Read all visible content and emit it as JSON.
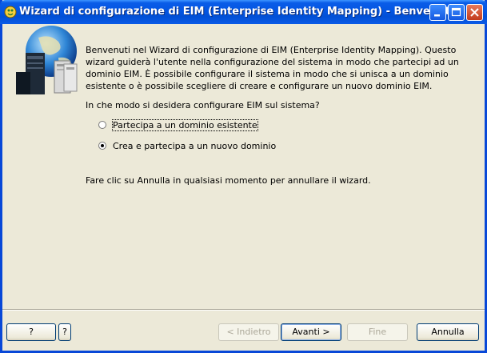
{
  "window": {
    "title": "Wizard di configurazione di EIM (Enterprise Identity Mapping) - Benvenuti"
  },
  "content": {
    "intro": "Benvenuti nel Wizard di configurazione di EIM (Enterprise Identity Mapping). Questo wizard guiderà l'utente nella configurazione del sistema in modo che partecipi ad un dominio EIM.  È possibile configurare il sistema in modo che si unisca a un dominio esistente o è possibile scegliere di creare e configurare un nuovo dominio EIM.",
    "question": "In che modo si desidera configurare EIM sul sistema?",
    "options": [
      {
        "label": "Partecipa a un dominio esistente",
        "selected": false
      },
      {
        "label": "Crea e partecipa a un nuovo dominio",
        "selected": true
      }
    ],
    "cancel_note": "Fare clic su Annulla in qualsiasi momento per annullare il wizard."
  },
  "footer": {
    "help_label": "?",
    "context_help_label": "?",
    "back_label": "< Indietro",
    "next_label": "Avanti >",
    "finish_label": "Fine",
    "cancel_label": "Annulla"
  },
  "colors": {
    "titlebar": "#0a5ce8",
    "dialog_bg": "#ece9d8",
    "disabled_text": "#aca899"
  }
}
